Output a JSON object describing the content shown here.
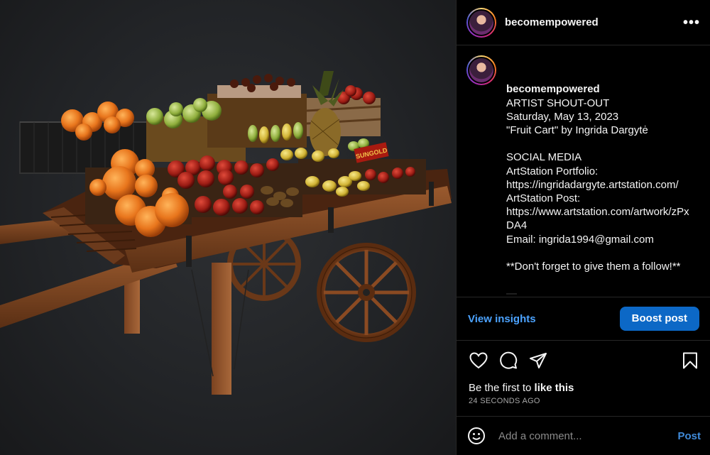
{
  "post": {
    "username": "becomempowered",
    "more_icon": "more-horizontal-icon"
  },
  "caption": {
    "username": "becomempowered",
    "text": "ARTIST SHOUT-OUT\nSaturday, May 13, 2023\n\"Fruit Cart\" by Ingrida Dargytė\n\nSOCIAL MEDIA\nArtStation Portfolio:\nhttps://ingridadargyte.artstation.com/\nArtStation Post:\nhttps://www.artstation.com/artwork/zPxDA4\nEmail: ingrida1994@gmail.com\n\n**Don't forget to give them a follow!**\n\n—\n\nThe Artist Shout-Outs are given to"
  },
  "insights": {
    "view_label": "View insights",
    "boost_label": "Boost post"
  },
  "actions": {
    "like_icon": "heart-icon",
    "comment_icon": "comment-icon",
    "share_icon": "share-icon",
    "save_icon": "bookmark-icon"
  },
  "likes": {
    "prefix": "Be the first to ",
    "link": "like this"
  },
  "timestamp": "24 SECONDS AGO",
  "comment": {
    "placeholder": "Add a comment...",
    "post_label": "Post",
    "emoji_icon": "emoji-icon"
  },
  "media": {
    "crate_label": "SUNGOLD"
  },
  "colors": {
    "accent": "#4ca3ff",
    "boost_button": "#0c68c6",
    "border": "#262626"
  }
}
